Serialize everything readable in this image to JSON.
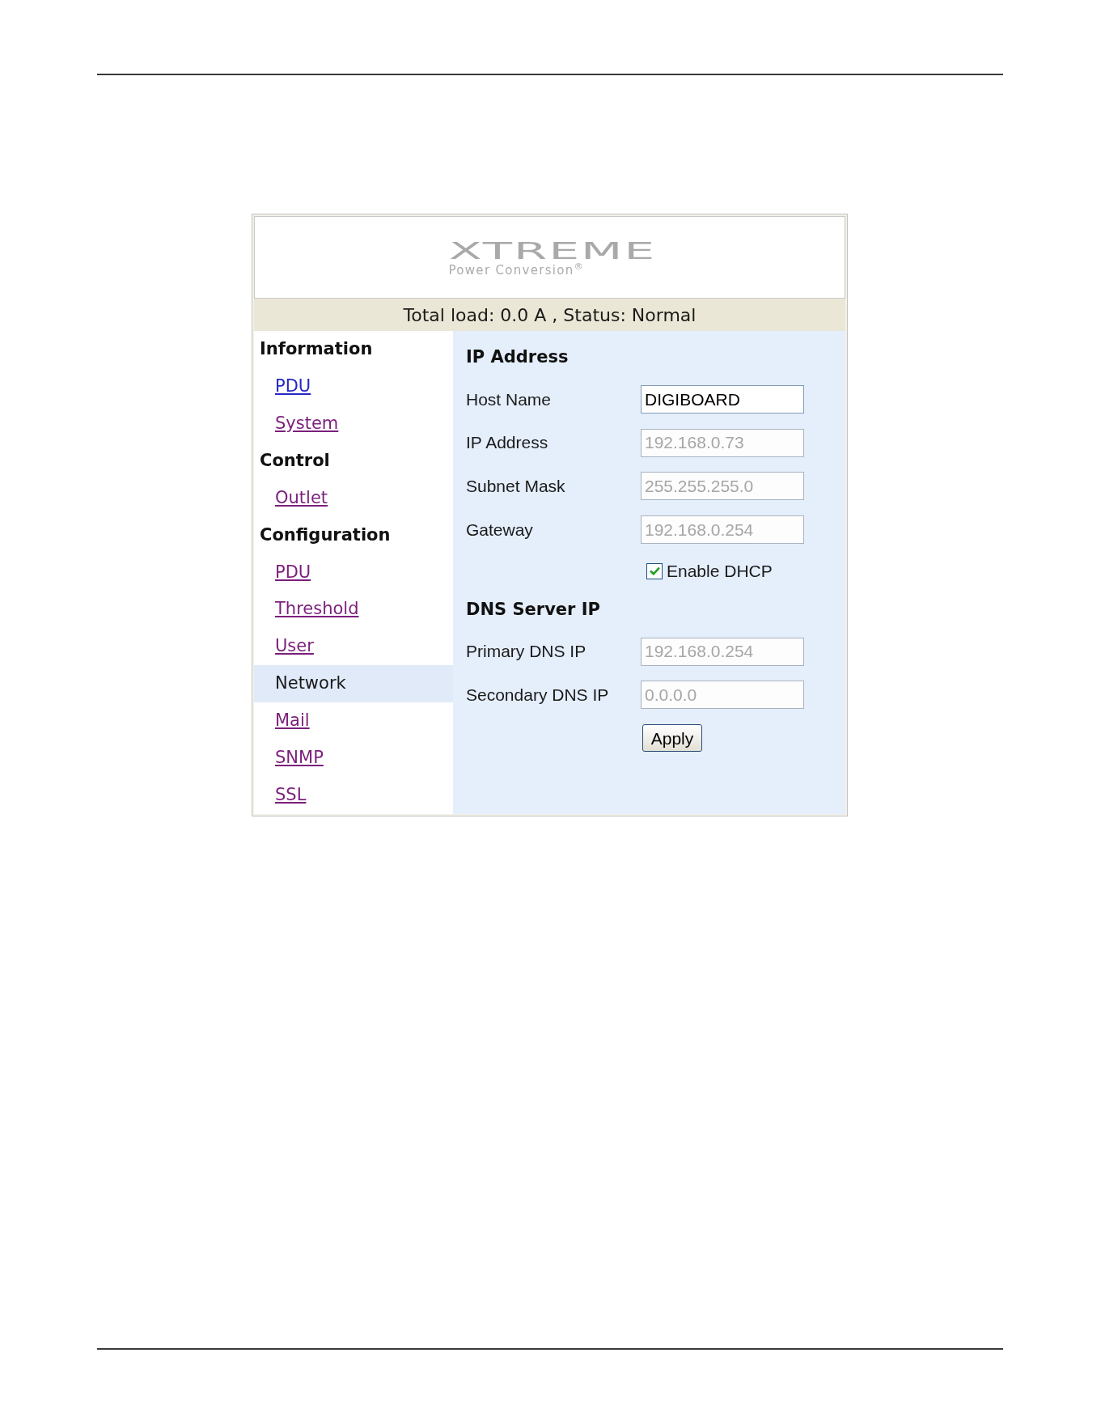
{
  "logo": {
    "wordmark": "XTREME",
    "tagline": "Power Conversion$^{®}$"
  },
  "status_bar": {
    "text": "Total load: 0.0 A , Status: Normal"
  },
  "sidebar": {
    "groups": [
      {
        "heading": "Information",
        "items": [
          {
            "label": "PDU",
            "selected": false,
            "visited": false
          },
          {
            "label": "System",
            "selected": false,
            "visited": true
          }
        ]
      },
      {
        "heading": "Control",
        "items": [
          {
            "label": "Outlet",
            "selected": false,
            "visited": true
          }
        ]
      },
      {
        "heading": "Configuration",
        "items": [
          {
            "label": "PDU",
            "selected": false,
            "visited": true
          },
          {
            "label": "Threshold",
            "selected": false,
            "visited": true
          },
          {
            "label": "User",
            "selected": false,
            "visited": true
          },
          {
            "label": "Network",
            "selected": true
          },
          {
            "label": "Mail",
            "selected": false,
            "visited": true
          },
          {
            "label": "SNMP",
            "selected": false,
            "visited": true
          },
          {
            "label": "SSL",
            "selected": false,
            "visited": true
          }
        ]
      }
    ]
  },
  "form": {
    "sections": [
      {
        "heading": "IP Address",
        "rows": [
          {
            "kind": "field",
            "label": "Host Name",
            "value": "DIGIBOARD",
            "disabled": false
          },
          {
            "kind": "field",
            "label": "IP Address",
            "value": "192.168.0.73",
            "disabled": true
          },
          {
            "kind": "field",
            "label": "Subnet Mask",
            "value": "255.255.255.0",
            "disabled": true
          },
          {
            "kind": "field",
            "label": "Gateway",
            "value": "192.168.0.254",
            "disabled": true
          },
          {
            "kind": "checkbox",
            "label": "Enable DHCP",
            "checked": true
          }
        ]
      },
      {
        "heading": "DNS Server IP",
        "rows": [
          {
            "kind": "field",
            "label": "Primary DNS IP",
            "value": "192.168.0.254",
            "disabled": true
          },
          {
            "kind": "field",
            "label": "Secondary DNS IP",
            "value": "0.0.0.0",
            "disabled": true
          }
        ]
      }
    ],
    "apply_button": "Apply"
  }
}
